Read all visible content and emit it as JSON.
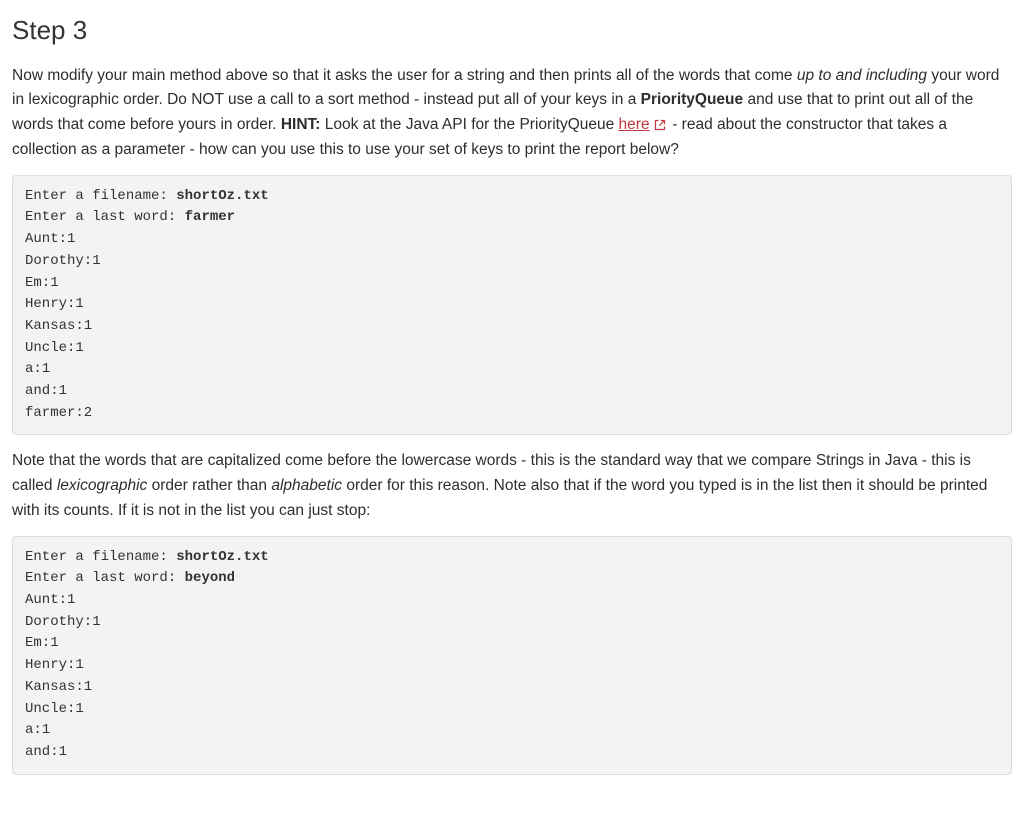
{
  "heading": "Step 3",
  "para1": {
    "t1": "Now modify your main method above so that it asks the user for a string and then prints all of the words that come ",
    "em1": "up to and including",
    "t2": " your word in lexicographic order.  Do NOT use a call to a sort method - instead put all of your keys in a ",
    "strong1": "PriorityQueue",
    "t3": " and use that to print out all of the words that come before yours in order.  ",
    "strong2": "HINT:",
    "t4": " Look at the Java API for the PriorityQueue ",
    "link": "here",
    "t5": " - read about the constructor that takes a collection as a parameter - how can you use this to use your set of keys to print the report below?"
  },
  "code1": {
    "prompt1_label": "Enter a filename: ",
    "prompt1_value": "shortOz.txt",
    "prompt2_label": "Enter a last word: ",
    "prompt2_value": "farmer",
    "lines": "Aunt:1\nDorothy:1\nEm:1\nHenry:1\nKansas:1\nUncle:1\na:1\nand:1\nfarmer:2"
  },
  "para2": {
    "t1": "Note that the words that are capitalized come before the lowercase words - this is the standard way that we compare Strings in Java - this is called ",
    "em1": "lexicographic",
    "t2": " order rather than ",
    "em2": "alphabetic",
    "t3": " order for this reason.  Note also that if the word you typed is in the list then it should be printed with its counts.  If it is not in the list you can just stop:"
  },
  "code2": {
    "prompt1_label": "Enter a filename: ",
    "prompt1_value": "shortOz.txt",
    "prompt2_label": "Enter a last word: ",
    "prompt2_value": "beyond",
    "lines": "Aunt:1\nDorothy:1\nEm:1\nHenry:1\nKansas:1\nUncle:1\na:1\nand:1"
  }
}
